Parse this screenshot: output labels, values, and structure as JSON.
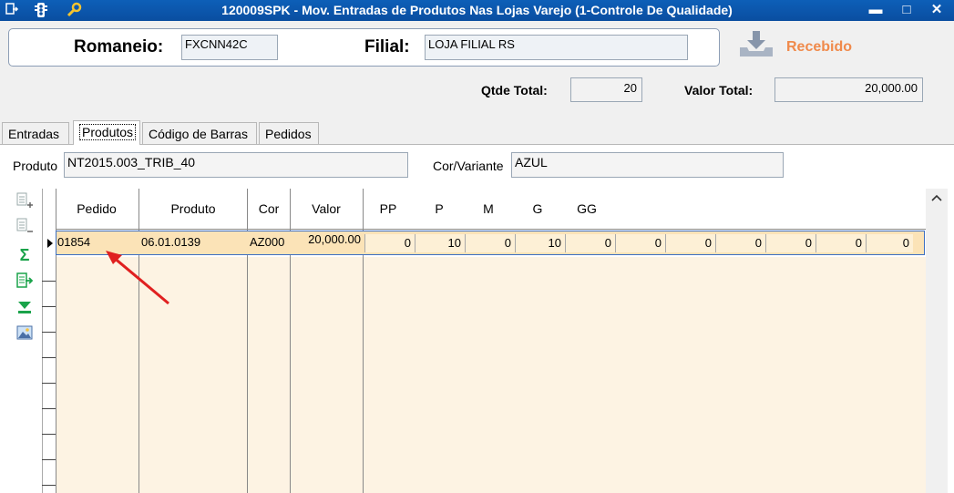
{
  "window": {
    "title": "120009SPK - Mov. Entradas de Produtos Nas Lojas Varejo (1-Controle De Qualidade)",
    "min_glyph": "▬",
    "max_glyph": "□",
    "close_glyph": "✕"
  },
  "header": {
    "romaneio_label": "Romaneio:",
    "romaneio_value": "FXCNN42C",
    "filial_label": "Filial:",
    "filial_value": "LOJA FILIAL RS",
    "status_label": "Recebido",
    "qtde_label": "Qtde Total:",
    "qtde_value": "20",
    "valor_label": "Valor Total:",
    "valor_value": "20,000.00"
  },
  "tabs": [
    "Entradas",
    "Produtos",
    "Código de Barras",
    "Pedidos"
  ],
  "produto_panel": {
    "produto_label": "Produto",
    "produto_value": "NT2015.003_TRIB_40",
    "cor_label": "Cor/Variante",
    "cor_value": "AZUL"
  },
  "grid": {
    "headers": [
      "Pedido",
      "Produto",
      "Cor",
      "Valor",
      "PP",
      "P",
      "M",
      "G",
      "GG"
    ],
    "row": {
      "pedido": "01854",
      "produto": "06.01.0139",
      "cor": "AZ000",
      "valor": "20,000.00",
      "sizes": [
        "0",
        "10",
        "0",
        "10",
        "0",
        "0",
        "0",
        "0",
        "0",
        "0",
        "0"
      ]
    }
  },
  "colors": {
    "titlebar": "#0a4ea0",
    "status_text": "#f08a4b",
    "row_selected": "#fbe3b7",
    "grid_body": "#fdf3e3",
    "annotation_arrow": "#e02020"
  }
}
